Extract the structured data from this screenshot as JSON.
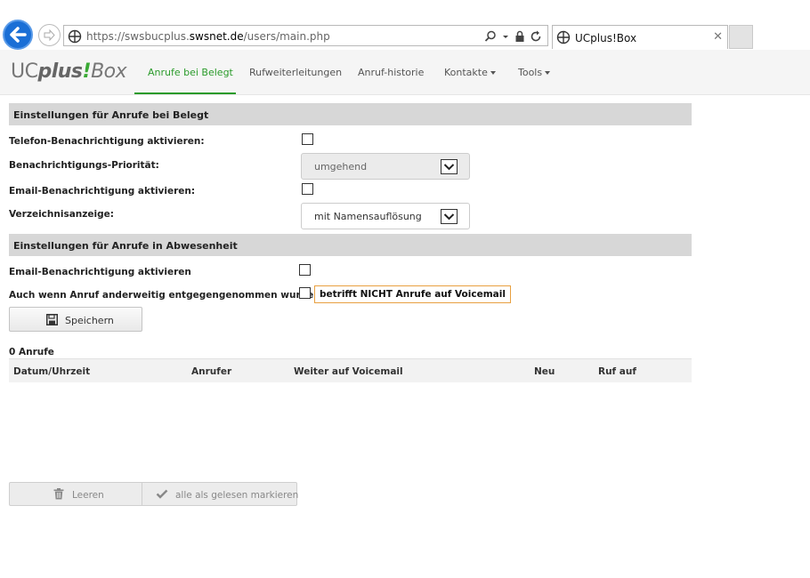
{
  "browser": {
    "url_prefix": "https://swsbucplus.",
    "url_host": "swsnet.de",
    "url_path": "/users/main.php",
    "tab_title": "UCplus!Box"
  },
  "app": {
    "logo_uc": "UC",
    "logo_plus": "plus",
    "logo_bang": "!",
    "logo_box": "Box"
  },
  "nav": {
    "items": [
      {
        "label": "Anrufe bei Belegt",
        "active": true
      },
      {
        "label": "Rufweiterleitungen"
      },
      {
        "label": "Anruf-historie"
      },
      {
        "label": "Kontakte"
      },
      {
        "label": "Tools"
      }
    ]
  },
  "busy_section": {
    "title": "Einstellungen für Anrufe bei Belegt",
    "phone_notify_label": "Telefon-Benachrichtigung aktivieren:",
    "priority_label": "Benachrichtigungs-Priorität:",
    "priority_value": "umgehend",
    "email_notify_label": "Email-Benachrichtigung aktivieren:",
    "directory_label": "Verzeichnisanzeige:",
    "directory_value": "mit Namensauflösung"
  },
  "absence_section": {
    "title": "Einstellungen für Anrufe in Abwesenheit",
    "email_notify_label": "Email-Benachrichtigung aktivieren",
    "also_answered_label": "Auch wenn Anruf anderweitig entgegengenommen wurde:",
    "voicemail_note": "betrifft NICHT Anrufe auf Voicemail"
  },
  "save_button": "Speichern",
  "calls": {
    "count": "0 Anrufe",
    "columns": [
      "Datum/Uhrzeit",
      "Anrufer",
      "Weiter auf Voicemail",
      "Neu",
      "Ruf auf"
    ]
  },
  "actions": {
    "clear": "Leeren",
    "mark_all_read": "alle als gelesen markieren"
  },
  "colors": {
    "accent": "#2b9b2b",
    "back_button": "#1a6fd6",
    "note_border": "#e8a040"
  }
}
